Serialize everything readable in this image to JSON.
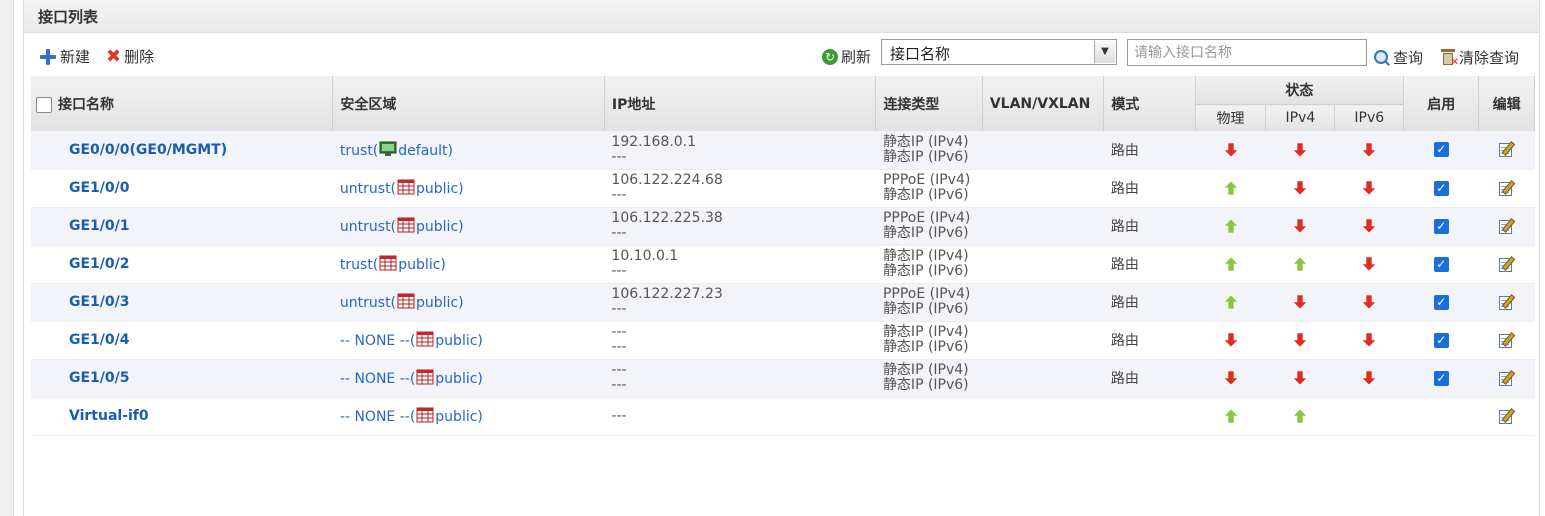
{
  "panel": {
    "title": "接口列表"
  },
  "toolbar": {
    "new_label": "新建",
    "delete_label": "删除",
    "refresh_label": "刷新",
    "filter_select": "接口名称",
    "search_placeholder": "请输入接口名称",
    "query_label": "查询",
    "clear_label": "清除查询"
  },
  "table": {
    "headers": {
      "name": "接口名称",
      "zone": "安全区域",
      "ip": "IP地址",
      "conn_type": "连接类型",
      "vlan": "VLAN/VXLAN",
      "mode": "模式",
      "status": "状态",
      "physical": "物理",
      "ipv4": "IPv4",
      "ipv6": "IPv6",
      "enabled": "启用",
      "edit": "编辑"
    },
    "rows": [
      {
        "name": "GE0/0/0(GE0/MGMT)",
        "zone": "trust(",
        "vsys": "default)",
        "vsys_icon": "green-monitor-icon",
        "ip1": "192.168.0.1",
        "ip2": "---",
        "conn1": "静态IP (IPv4)",
        "conn2": "静态IP (IPv6)",
        "mode": "路由",
        "physical": "down",
        "ipv4": "down",
        "ipv6": "down",
        "enabled": true
      },
      {
        "name": "GE1/0/0",
        "zone": "untrust(",
        "vsys": "public)",
        "vsys_icon": "red-grid-icon",
        "ip1": "106.122.224.68",
        "ip2": "---",
        "conn1": "PPPoE (IPv4)",
        "conn2": "静态IP (IPv6)",
        "mode": "路由",
        "physical": "up",
        "ipv4": "down",
        "ipv6": "down",
        "enabled": true
      },
      {
        "name": "GE1/0/1",
        "zone": "untrust(",
        "vsys": "public)",
        "vsys_icon": "red-grid-icon",
        "ip1": "106.122.225.38",
        "ip2": "---",
        "conn1": "PPPoE (IPv4)",
        "conn2": "静态IP (IPv6)",
        "mode": "路由",
        "physical": "up",
        "ipv4": "down",
        "ipv6": "down",
        "enabled": true
      },
      {
        "name": "GE1/0/2",
        "zone": "trust(",
        "vsys": "public)",
        "vsys_icon": "red-grid-icon",
        "ip1": "10.10.0.1",
        "ip2": "---",
        "conn1": "静态IP (IPv4)",
        "conn2": "静态IP (IPv6)",
        "mode": "路由",
        "physical": "up",
        "ipv4": "up",
        "ipv6": "down",
        "enabled": true
      },
      {
        "name": "GE1/0/3",
        "zone": "untrust(",
        "vsys": "public)",
        "vsys_icon": "red-grid-icon",
        "ip1": "106.122.227.23",
        "ip2": "---",
        "conn1": "PPPoE (IPv4)",
        "conn2": "静态IP (IPv6)",
        "mode": "路由",
        "physical": "up",
        "ipv4": "down",
        "ipv6": "down",
        "enabled": true
      },
      {
        "name": "GE1/0/4",
        "zone": "-- NONE --(",
        "vsys": "public)",
        "vsys_icon": "red-grid-icon",
        "ip1": "---",
        "ip2": "---",
        "conn1": "静态IP (IPv4)",
        "conn2": "静态IP (IPv6)",
        "mode": "路由",
        "physical": "down",
        "ipv4": "down",
        "ipv6": "down",
        "enabled": true
      },
      {
        "name": "GE1/0/5",
        "zone": "-- NONE --(",
        "vsys": "public)",
        "vsys_icon": "red-grid-icon",
        "ip1": "---",
        "ip2": "---",
        "conn1": "静态IP (IPv4)",
        "conn2": "静态IP (IPv6)",
        "mode": "路由",
        "physical": "down",
        "ipv4": "down",
        "ipv6": "down",
        "enabled": true
      },
      {
        "name": "Virtual-if0",
        "zone": "-- NONE --(",
        "vsys": "public)",
        "vsys_icon": "red-grid-icon",
        "ip1": "---",
        "ip2": "",
        "conn1": "",
        "conn2": "",
        "mode": "",
        "physical": "up",
        "ipv4": "up",
        "ipv6": "",
        "enabled": null
      }
    ]
  },
  "colors": {
    "link": "#1a5cb4",
    "up_arrow": "#8cc63f",
    "down_arrow": "#e02b20",
    "checkbox": "#1b6fd8"
  }
}
